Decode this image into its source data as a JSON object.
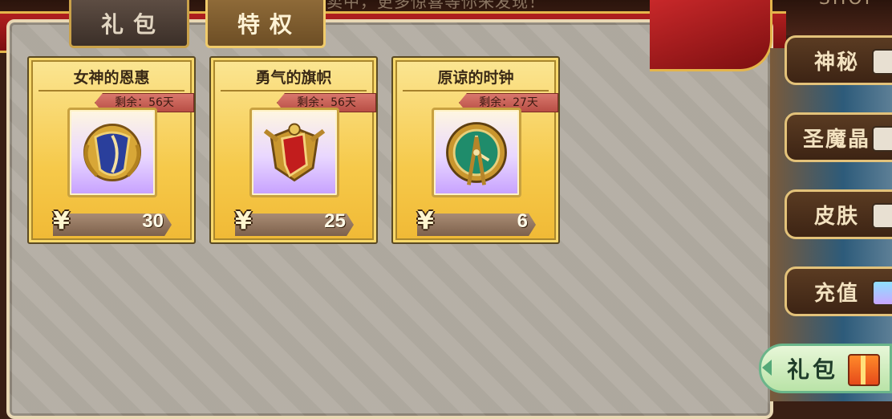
{
  "header": {
    "banner_text": "特权礼包限时热卖中，更多惊喜等你来发现！",
    "shop_label": "SHOP"
  },
  "tabs": [
    {
      "label": "礼包",
      "active": false
    },
    {
      "label": "特权",
      "active": true
    }
  ],
  "cards": [
    {
      "title": "女神的恩惠",
      "remaining": "剩余：56天",
      "currency": "¥",
      "price": "30",
      "icon": "goddess-shield-icon"
    },
    {
      "title": "勇气的旗帜",
      "remaining": "剩余：56天",
      "currency": "¥",
      "price": "25",
      "icon": "red-banner-crest-icon"
    },
    {
      "title": "原谅的时钟",
      "remaining": "剩余：27天",
      "currency": "¥",
      "price": "6",
      "icon": "emerald-clock-icon"
    }
  ],
  "side_nav": [
    {
      "label": "神秘",
      "icon": "dice-icon"
    },
    {
      "label": "圣魔晶",
      "icon": "crystal-icon"
    },
    {
      "label": "皮肤",
      "icon": "costume-icon"
    },
    {
      "label": "充值",
      "icon": "gem-icon"
    }
  ],
  "gift_button": {
    "label": "礼包",
    "icon": "gift-box-icon"
  },
  "colors": {
    "card_gold": "#f6c94a",
    "ribbon_red": "#b01f1f",
    "timer_red": "#d9776c",
    "panel_gray": "#b3ada3",
    "gift_green": "#b9e3a7"
  }
}
